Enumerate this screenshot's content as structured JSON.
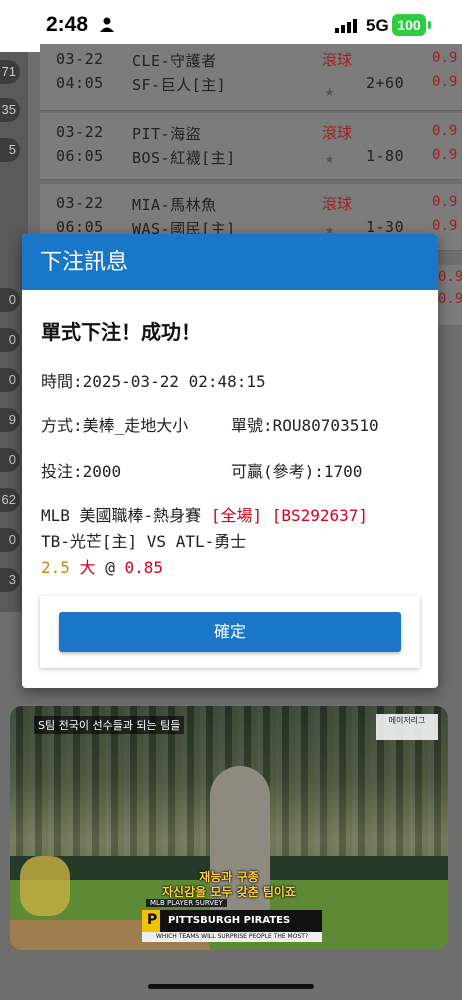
{
  "status_bar": {
    "time": "2:48",
    "network": "5G",
    "battery": "100"
  },
  "side_pills": [
    "71",
    "35",
    "5",
    "0",
    "0",
    "0",
    "9",
    "0",
    "62",
    "0",
    "3"
  ],
  "games": [
    {
      "date": "03-22",
      "time": "04:05",
      "away": "CLE-守護者",
      "home": "SF-巨人[主]",
      "live": "滾球",
      "line": "2+60",
      "odds1": "0.9",
      "odds2": "0.9"
    },
    {
      "date": "03-22",
      "time": "06:05",
      "away": "PIT-海盜",
      "home": "BOS-紅襪[主]",
      "live": "滾球",
      "line": "1-80",
      "odds1": "0.9",
      "odds2": "0.9"
    },
    {
      "date": "03-22",
      "time": "06:05",
      "away": "MIA-馬林魚",
      "home": "WAS-國民[主]",
      "live": "滾球",
      "line": "1-30",
      "odds1": "0.9",
      "odds2": "0.9"
    }
  ],
  "right_odds": [
    "0.9",
    "0.9"
  ],
  "dialog": {
    "title": "下注訊息",
    "success": "單式下注！成功！",
    "time_line": "時間:2025-03-22 02:48:15",
    "method": "方式:美棒_走地大小",
    "ticket": "單號:ROU80703510",
    "stake": "投注:2000",
    "win": "可贏(參考):1700",
    "league": "MLB 美國職棒-熱身賽",
    "period": "[全場]",
    "code": "[BS292637]",
    "matchup": "TB-光芒[主] VS ATL-勇士",
    "handicap": "2.5",
    "pick": "大",
    "at": "@",
    "price": "0.85",
    "confirm": "確定"
  },
  "video": {
    "caption_top": "S팀 전국이 선수들과 되는 팀들",
    "logo": "메이저리그",
    "korean_line1": "재능과 구종",
    "korean_line2": "자신감을 모두 갖춘 팀이죠",
    "survey": "MLB PLAYER SURVEY",
    "team": "PITTSBURGH PIRATES",
    "team_letter": "P",
    "question": "WHICH TEAMS WILL SURPRISE PEOPLE THE MOST?"
  }
}
